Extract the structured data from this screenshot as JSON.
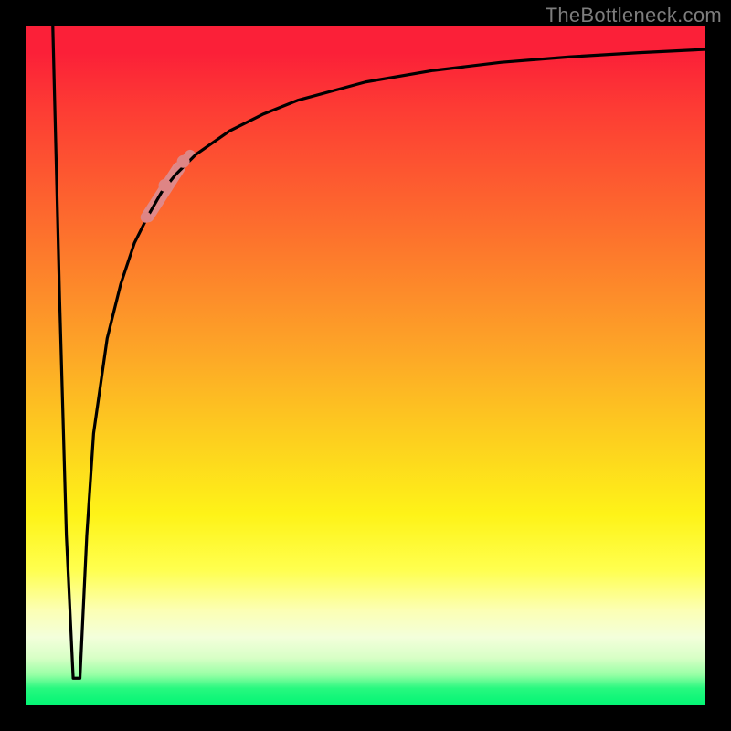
{
  "watermark": "TheBottleneck.com",
  "chart_data": {
    "type": "line",
    "title": "",
    "xlabel": "",
    "ylabel": "",
    "xlim": [
      0,
      100
    ],
    "ylim": [
      0,
      100
    ],
    "series": [
      {
        "name": "bottleneck-curve",
        "color": "#000000",
        "x": [
          4,
          5,
          6,
          7,
          8,
          9,
          10,
          12,
          14,
          16,
          18,
          20,
          22,
          25,
          30,
          35,
          40,
          50,
          60,
          70,
          80,
          90,
          100
        ],
        "y": [
          100,
          60,
          25,
          4,
          4,
          25,
          40,
          54,
          62,
          68,
          72,
          75.5,
          78,
          81,
          84.5,
          87,
          89,
          91.7,
          93.4,
          94.6,
          95.4,
          96,
          96.5
        ]
      }
    ],
    "highlight_segments": [
      {
        "name": "pink-segment-upper",
        "color": "#e08989",
        "width": 14,
        "x": [
          18,
          22.5
        ],
        "y": [
          72,
          79
        ]
      },
      {
        "name": "pink-segment-lower",
        "color": "#de8686",
        "width": 11,
        "x": [
          22.5,
          24.2
        ],
        "y": [
          79,
          81
        ]
      }
    ],
    "highlight_dots": [
      {
        "name": "pink-dot-1",
        "color": "#de8585",
        "r": 7,
        "x": 20.5,
        "y": 76.5
      },
      {
        "name": "pink-dot-2",
        "color": "#de8585",
        "r": 7,
        "x": 23.2,
        "y": 80
      },
      {
        "name": "pink-dot-3",
        "color": "#de8585",
        "r": 6,
        "x": 17.7,
        "y": 71.8
      }
    ]
  }
}
